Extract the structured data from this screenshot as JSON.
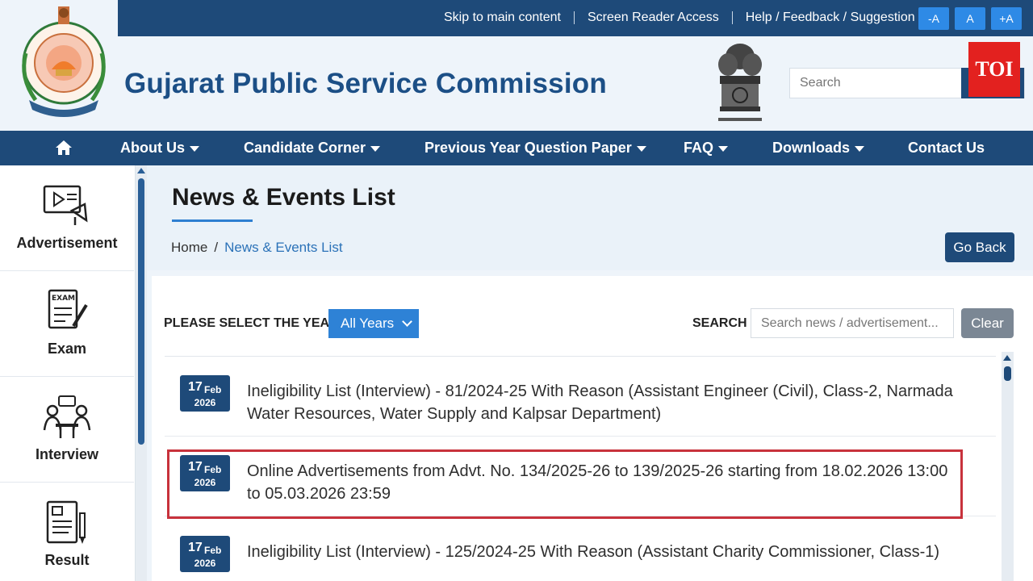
{
  "topbar": {
    "skip": "Skip to main content",
    "screen_reader": "Screen Reader Access",
    "help": "Help / Feedback / Suggestion",
    "font_buttons": [
      "-A",
      "A",
      "+A"
    ]
  },
  "header": {
    "site_title": "Gujarat Public Service Commission",
    "search_placeholder": "Search",
    "badge": "TOI"
  },
  "nav": {
    "home_icon": "home-icon",
    "items": [
      {
        "label": "About Us",
        "dropdown": true
      },
      {
        "label": "Candidate Corner",
        "dropdown": true
      },
      {
        "label": "Previous Year Question Paper",
        "dropdown": true
      },
      {
        "label": "FAQ",
        "dropdown": true
      },
      {
        "label": "Downloads",
        "dropdown": true
      },
      {
        "label": "Contact Us",
        "dropdown": false
      }
    ]
  },
  "sidebar": {
    "items": [
      {
        "label": "Advertisement",
        "icon": "advertisement-icon"
      },
      {
        "label": "Exam",
        "icon": "exam-icon"
      },
      {
        "label": "Interview",
        "icon": "interview-icon"
      },
      {
        "label": "Result",
        "icon": "result-icon"
      }
    ]
  },
  "page": {
    "title": "News & Events List",
    "breadcrumb": [
      "Home",
      "/",
      "News & Events List"
    ],
    "go_back": "Go Back"
  },
  "filters": {
    "year_label": "PLEASE SELECT THE YEAR",
    "year_value": "All Years",
    "search_label": "SEARCH",
    "search_placeholder": "Search news / advertisement...",
    "clear": "Clear"
  },
  "news": [
    {
      "day": "17",
      "month": "Feb",
      "year": "2026",
      "text": "Ineligibility List (Interview) - 81/2024-25 With Reason (Assistant Engineer (Civil), Class-2, Narmada Water Resources, Water Supply and Kalpsar Department)"
    },
    {
      "day": "17",
      "month": "Feb",
      "year": "2026",
      "text": "Online Advertisements from Advt. No. 134/2025-26 to 139/2025-26 starting from 18.02.2026 13:00 to 05.03.2026 23:59"
    },
    {
      "day": "17",
      "month": "Feb",
      "year": "2026",
      "text": "Ineligibility List (Interview) - 125/2024-25 With Reason (Assistant Charity Commissioner, Class-1)"
    }
  ],
  "colors": {
    "primary": "#1e4a79",
    "accent": "#2e82d6",
    "highlight": "#c8323c",
    "badge": "#e3211f"
  }
}
